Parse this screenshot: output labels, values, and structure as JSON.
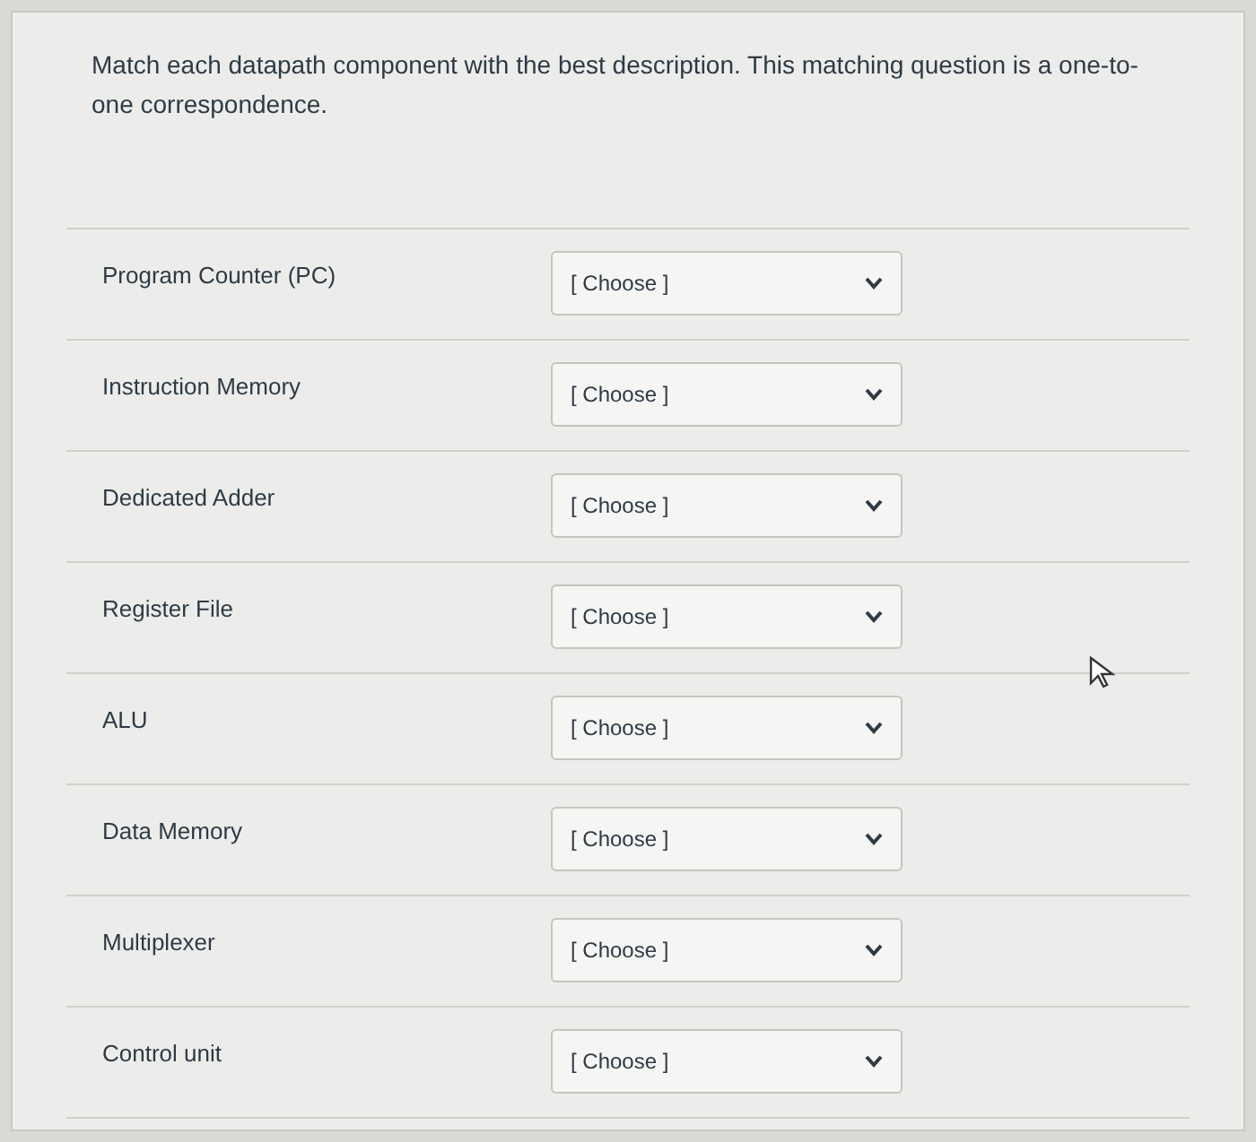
{
  "question": "Match each datapath component with the best description. This matching question is a one-to-one correspondence.",
  "rows": [
    {
      "label": "Program Counter (PC)",
      "select": "[ Choose ]"
    },
    {
      "label": "Instruction Memory",
      "select": "[ Choose ]"
    },
    {
      "label": "Dedicated Adder",
      "select": "[ Choose ]"
    },
    {
      "label": "Register File",
      "select": "[ Choose ]"
    },
    {
      "label": "ALU",
      "select": "[ Choose ]"
    },
    {
      "label": "Data Memory",
      "select": "[ Choose ]"
    },
    {
      "label": "Multiplexer",
      "select": "[ Choose ]"
    },
    {
      "label": "Control unit",
      "select": "[ Choose ]"
    }
  ]
}
